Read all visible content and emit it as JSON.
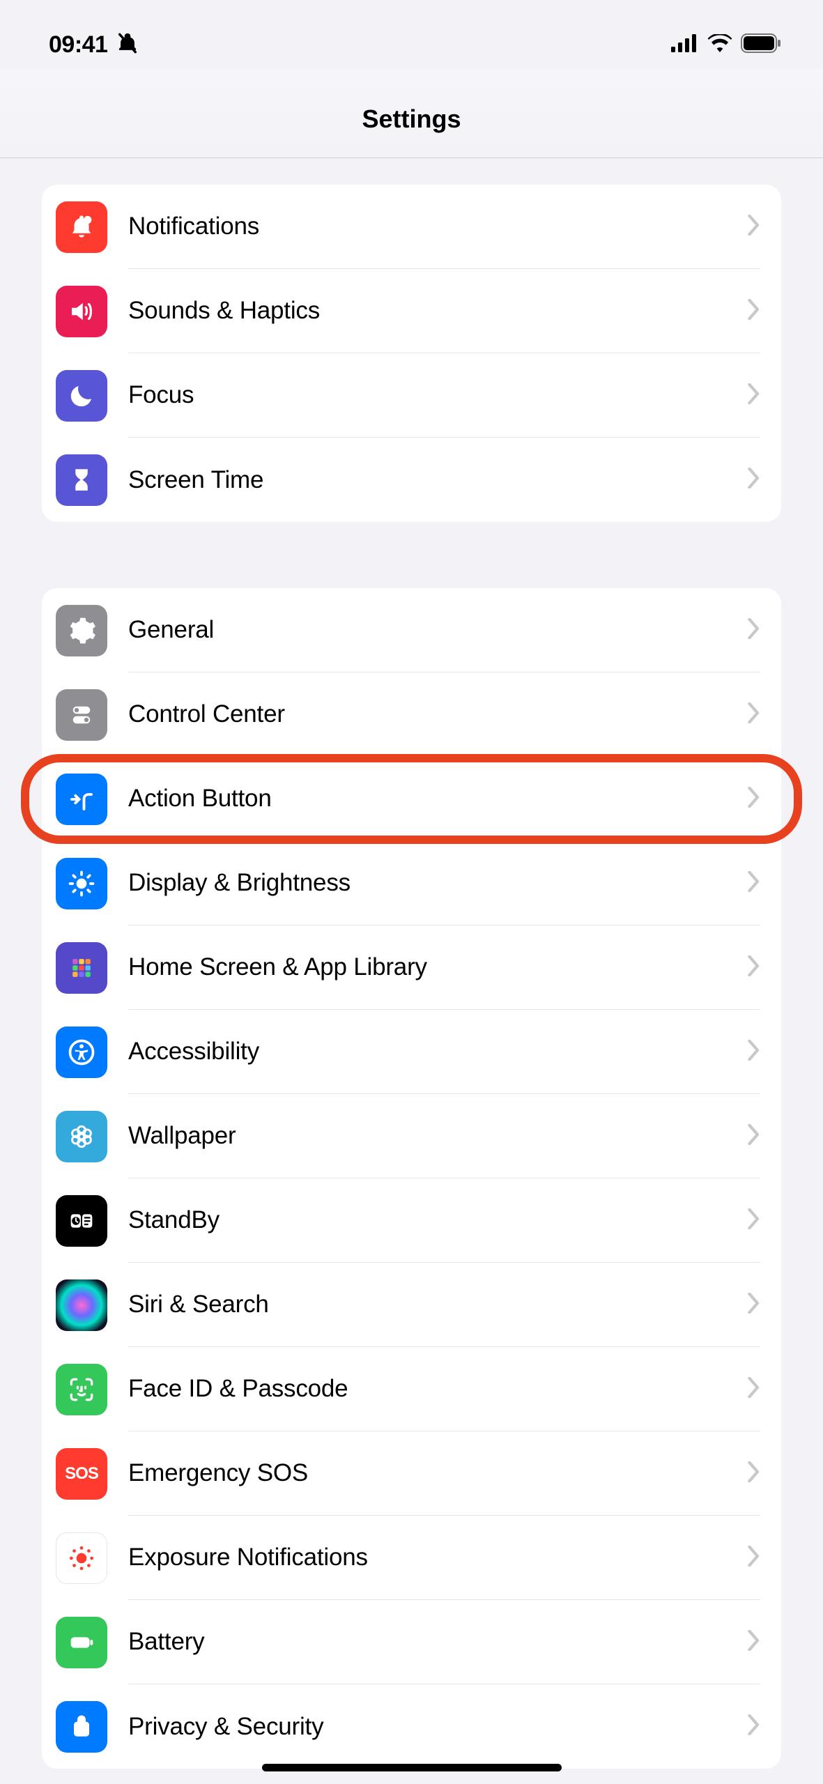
{
  "status": {
    "time": "09:41"
  },
  "header": {
    "title": "Settings"
  },
  "groups": [
    {
      "items": [
        {
          "id": "notifications",
          "label": "Notifications"
        },
        {
          "id": "sounds",
          "label": "Sounds & Haptics"
        },
        {
          "id": "focus",
          "label": "Focus"
        },
        {
          "id": "screen-time",
          "label": "Screen Time"
        }
      ]
    },
    {
      "items": [
        {
          "id": "general",
          "label": "General"
        },
        {
          "id": "control-center",
          "label": "Control Center"
        },
        {
          "id": "action-button",
          "label": "Action Button",
          "highlighted": true
        },
        {
          "id": "display",
          "label": "Display & Brightness"
        },
        {
          "id": "home-screen",
          "label": "Home Screen & App Library"
        },
        {
          "id": "accessibility",
          "label": "Accessibility"
        },
        {
          "id": "wallpaper",
          "label": "Wallpaper"
        },
        {
          "id": "standby",
          "label": "StandBy"
        },
        {
          "id": "siri",
          "label": "Siri & Search"
        },
        {
          "id": "faceid",
          "label": "Face ID & Passcode"
        },
        {
          "id": "sos",
          "label": "Emergency SOS",
          "badge_text": "SOS"
        },
        {
          "id": "exposure",
          "label": "Exposure Notifications"
        },
        {
          "id": "battery",
          "label": "Battery"
        },
        {
          "id": "privacy",
          "label": "Privacy & Security"
        }
      ]
    }
  ],
  "icon_colors": {
    "notifications": "#ff3b30",
    "sounds": "#ea1d54",
    "focus": "#5856d6",
    "screen-time": "#5856d6",
    "general": "#8e8e93",
    "control-center": "#8e8e93",
    "action-button": "#007aff",
    "display": "#007aff",
    "home-screen": "#5856d6",
    "accessibility": "#007aff",
    "wallpaper": "#34aadc",
    "standby": "#000000",
    "siri": "#1a1a26",
    "faceid": "#34c759",
    "sos": "#ff3b30",
    "exposure": "#ffffff",
    "battery": "#34c759",
    "privacy": "#007aff"
  }
}
